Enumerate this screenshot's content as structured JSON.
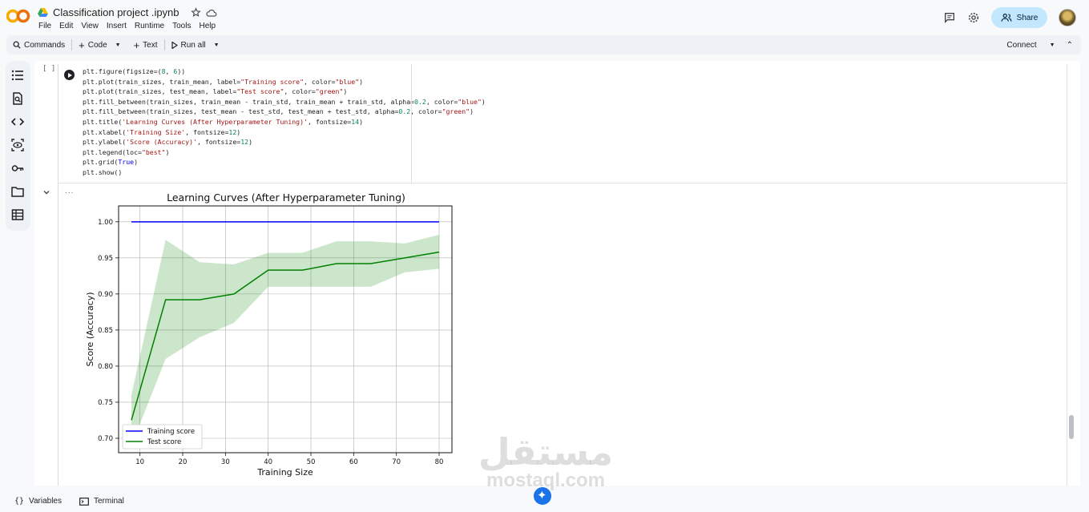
{
  "header": {
    "title": "Classification project .ipynb",
    "menu": [
      "File",
      "Edit",
      "View",
      "Insert",
      "Runtime",
      "Tools",
      "Help"
    ],
    "share_label": "Share"
  },
  "toolbar": {
    "commands": "Commands",
    "code": "Code",
    "text": "Text",
    "run_all": "Run all",
    "connect": "Connect"
  },
  "cell": {
    "bracket": "[ ]",
    "code_lines": [
      "plt.figure(figsize=(8, 6))",
      "plt.plot(train_sizes, train_mean, label=\"Training score\", color=\"blue\")",
      "plt.plot(train_sizes, test_mean, label=\"Test score\", color=\"green\")",
      "plt.fill_between(train_sizes, train_mean - train_std, train_mean + train_std, alpha=0.2, color=\"blue\")",
      "plt.fill_between(train_sizes, test_mean - test_std, test_mean + test_std, alpha=0.2, color=\"green\")",
      "plt.title('Learning Curves (After Hyperparameter Tuning)', fontsize=14)",
      "plt.xlabel('Training Size', fontsize=12)",
      "plt.ylabel('Score (Accuracy)', fontsize=12)",
      "plt.legend(loc=\"best\")",
      "plt.grid(True)",
      "plt.show()"
    ],
    "output_dots": "..."
  },
  "chart_data": {
    "type": "line",
    "title": "Learning Curves (After Hyperparameter Tuning)",
    "xlabel": "Training Size",
    "ylabel": "Score (Accuracy)",
    "xlim": [
      5,
      83
    ],
    "ylim": [
      0.68,
      1.022
    ],
    "xticks": [
      10,
      20,
      30,
      40,
      50,
      60,
      70,
      80
    ],
    "yticks": [
      0.7,
      0.75,
      0.8,
      0.85,
      0.9,
      0.95,
      1.0
    ],
    "grid": true,
    "legend_loc": "lower-left",
    "x": [
      8,
      16,
      24,
      32,
      40,
      48,
      56,
      64,
      72,
      80
    ],
    "series": [
      {
        "name": "Training score",
        "color": "#0000ff",
        "values": [
          1.0,
          1.0,
          1.0,
          1.0,
          1.0,
          1.0,
          1.0,
          1.0,
          1.0,
          1.0
        ],
        "lower": [
          1.0,
          1.0,
          1.0,
          1.0,
          1.0,
          1.0,
          1.0,
          1.0,
          1.0,
          1.0
        ],
        "upper": [
          1.0,
          1.0,
          1.0,
          1.0,
          1.0,
          1.0,
          1.0,
          1.0,
          1.0,
          1.0
        ]
      },
      {
        "name": "Test score",
        "color": "#008000",
        "values": [
          0.725,
          0.892,
          0.892,
          0.9,
          0.933,
          0.933,
          0.942,
          0.942,
          0.95,
          0.958
        ],
        "lower": [
          0.69,
          0.81,
          0.84,
          0.86,
          0.91,
          0.91,
          0.91,
          0.91,
          0.93,
          0.935
        ],
        "upper": [
          0.76,
          0.975,
          0.944,
          0.941,
          0.957,
          0.957,
          0.973,
          0.973,
          0.97,
          0.982
        ]
      }
    ]
  },
  "watermark": {
    "arabic": "مستقل",
    "latin": "mostaql.com"
  },
  "status": {
    "variables": "Variables",
    "terminal": "Terminal"
  }
}
